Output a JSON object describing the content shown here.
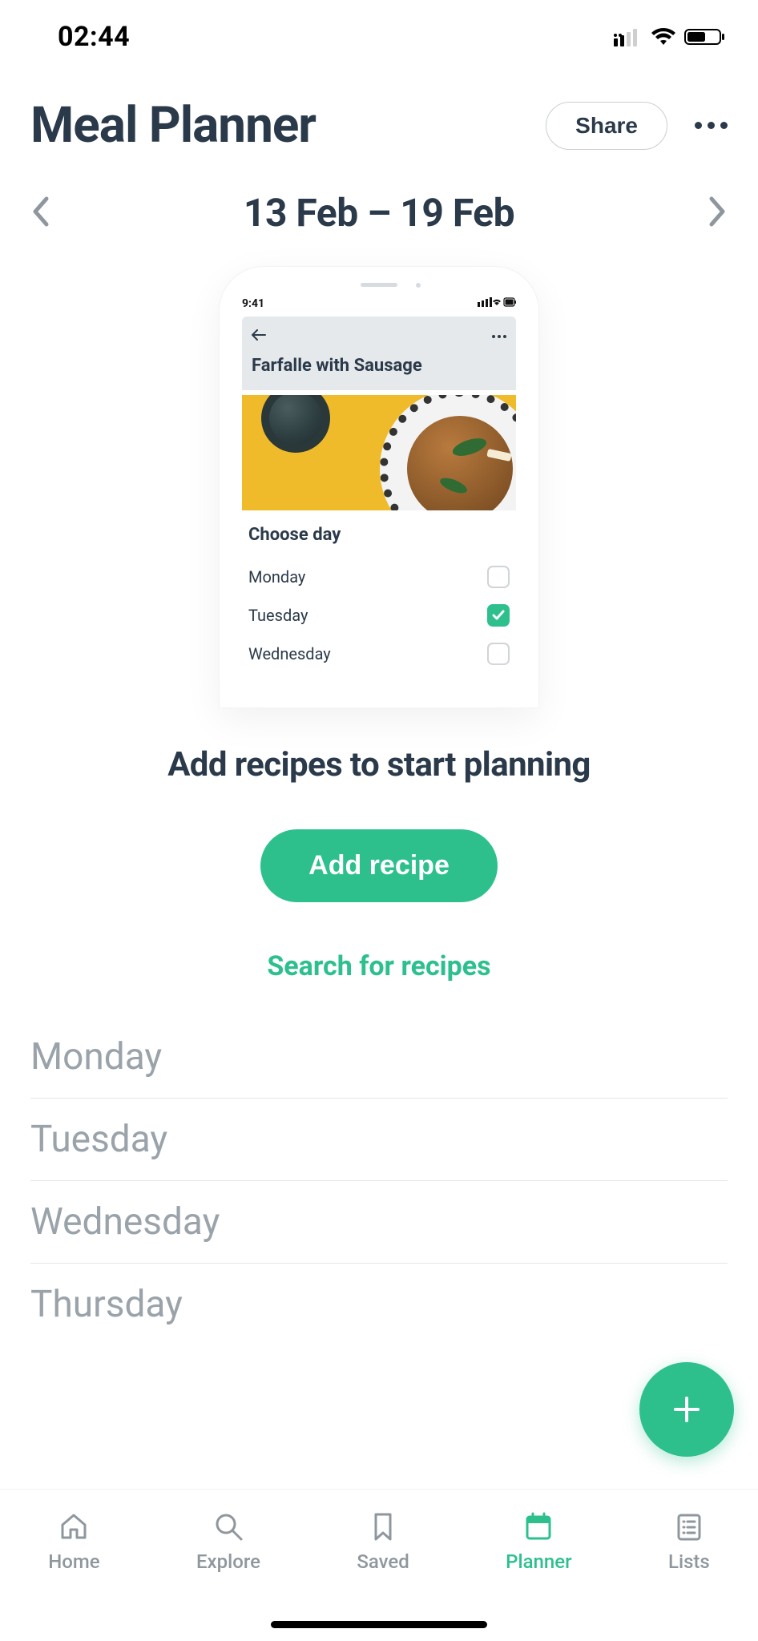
{
  "status": {
    "time": "02:44"
  },
  "header": {
    "title": "Meal Planner",
    "share_label": "Share"
  },
  "date_nav": {
    "range": "13 Feb – 19 Feb"
  },
  "illustration": {
    "phone_time": "9:41",
    "recipe_title": "Farfalle with Sausage",
    "choose_day_title": "Choose day",
    "days": {
      "mon": "Monday",
      "tue": "Tuesday",
      "wed": "Wednesday"
    },
    "checked_day": "Tuesday"
  },
  "empty_state": {
    "prompt": "Add recipes to start planning",
    "add_button": "Add recipe",
    "search_link": "Search for recipes"
  },
  "week": {
    "mon": "Monday",
    "tue": "Tuesday",
    "wed": "Wednesday",
    "thu": "Thursday"
  },
  "tabs": {
    "home": "Home",
    "explore": "Explore",
    "saved": "Saved",
    "planner": "Planner",
    "lists": "Lists"
  },
  "colors": {
    "accent": "#2dc08d",
    "text_primary": "#2b3a4a",
    "text_muted": "#9aa3aa"
  }
}
